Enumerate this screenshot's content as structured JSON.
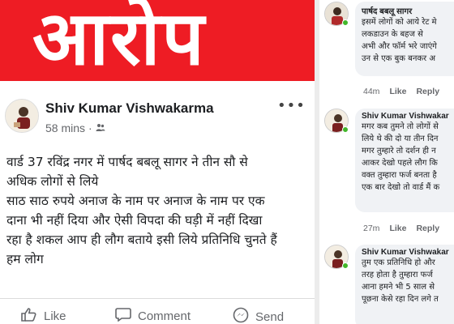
{
  "banner": {
    "text": "आरोप"
  },
  "post": {
    "author": "Shiv Kumar Vishwakarma",
    "time": "58 mins",
    "separator": "·",
    "more_label": "•••",
    "body_lines": [
      "वार्ड 37 रविंद्र नगर में पार्षद बबलू सागर ने तीन सौ से",
      "अधिक लोगों से लिये",
      "साठ साठ रुपये अनाज के नाम पर अनाज के नाम पर एक",
      "दाना भी नहीं दिया और ऐसी विपदा की घड़ी में नहीं दिखा",
      "रहा है शकल आप ही लौग बताये इसी लिये प्रतिनिधि चुनते हैं",
      "हम लोग"
    ],
    "actions": {
      "like": "Like",
      "comment": "Comment",
      "send": "Send"
    }
  },
  "comments": [
    {
      "name": "पार्षद बबलू सागर",
      "lines": [
        "इसमें लोगों को आये रेट मे",
        "लकडाउन के बहज से",
        "अभी और फॉर्म भरे जाएंगे",
        "उन से एक बुक बनकर अ"
      ],
      "time": "44m",
      "like": "Like",
      "reply": "Reply"
    },
    {
      "name": "Shiv Kumar Vishwakar",
      "lines": [
        "मगर कब तुमने तो लोगों से",
        "लिये थे की दो या तीन दिन",
        "मगर तुम्हारे तो दर्शन ही न",
        "आकर देखो पहले लौग कि",
        "वक्त तुम्हारा फर्ज बनता है",
        "एक बार देखो तो वार्ड मैं क"
      ],
      "time": "27m",
      "like": "Like",
      "reply": "Reply"
    },
    {
      "name": "Shiv Kumar Vishwakar",
      "lines": [
        "तुम एक प्रतिनिधि हो और",
        "तरह होता है तुम्हारा फर्ज",
        "आना हमने भी 5 साल से",
        "पूछना केसे रहा दिन लगे त"
      ]
    }
  ],
  "colors": {
    "banner": "#ee1c24",
    "online": "#42b72a"
  },
  "icons": {
    "audience": "friends-icon",
    "like": "thumbs-up-icon",
    "comment": "comment-bubble-icon",
    "send": "messenger-icon"
  }
}
